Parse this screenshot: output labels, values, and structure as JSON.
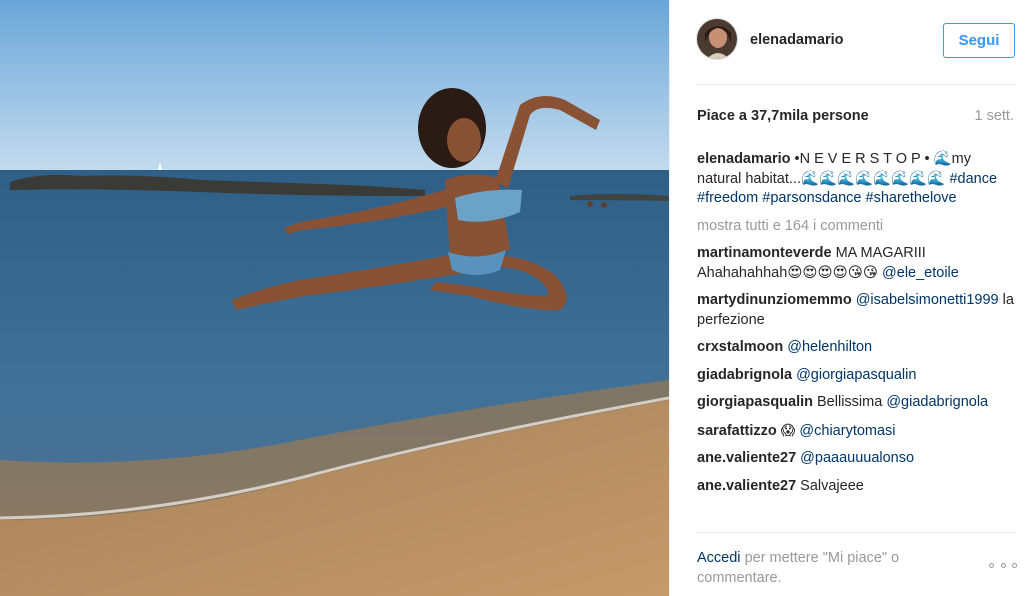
{
  "post": {
    "username": "elenadamario",
    "follow_label": "Segui",
    "likes": "Piace a 37,7mila persone",
    "time": "1 sett."
  },
  "caption": {
    "user": "elenadamario",
    "text": "•N E V E R S T O P • 🌊my natural habitat...🌊🌊🌊🌊🌊🌊🌊🌊",
    "hashtags": [
      "#dance",
      "#freedom",
      "#parsonsdance",
      "#sharethelove"
    ]
  },
  "show_all": "mostra tutti e 164 i commenti",
  "comments": [
    {
      "user": "martinamonteverde",
      "text": "MA MAGARIII Ahahahahhah😍😍😍😍😘😘",
      "tag": "@ele_etoile"
    },
    {
      "user": "martydinunziomemmo",
      "tag": "@isabelsimonetti1999",
      "text": "la perfezione"
    },
    {
      "user": "crxstalmoon",
      "tag": "@helenhilton",
      "text": ""
    },
    {
      "user": "giadabrignola",
      "tag": "@giorgiapasqualin",
      "text": ""
    },
    {
      "user": "giorgiapasqualin",
      "text": "Bellissima",
      "tag": "@giadabrignola"
    },
    {
      "user": "sarafattizzo",
      "text": "😱",
      "tag": "@chiarytomasi"
    },
    {
      "user": "ane.valiente27",
      "tag": "@paaauuualonso",
      "text": ""
    },
    {
      "user": "ane.valiente27",
      "text": "Salvajeee",
      "tag": ""
    }
  ],
  "footer": {
    "login": "Accedi",
    "text": "per mettere \"Mi piace\" o commentare."
  },
  "colors": {
    "link": "#3897f0",
    "hashtag": "#003569",
    "muted": "#999999",
    "text": "#262626"
  },
  "icons": {
    "options": "more-options-icon"
  }
}
